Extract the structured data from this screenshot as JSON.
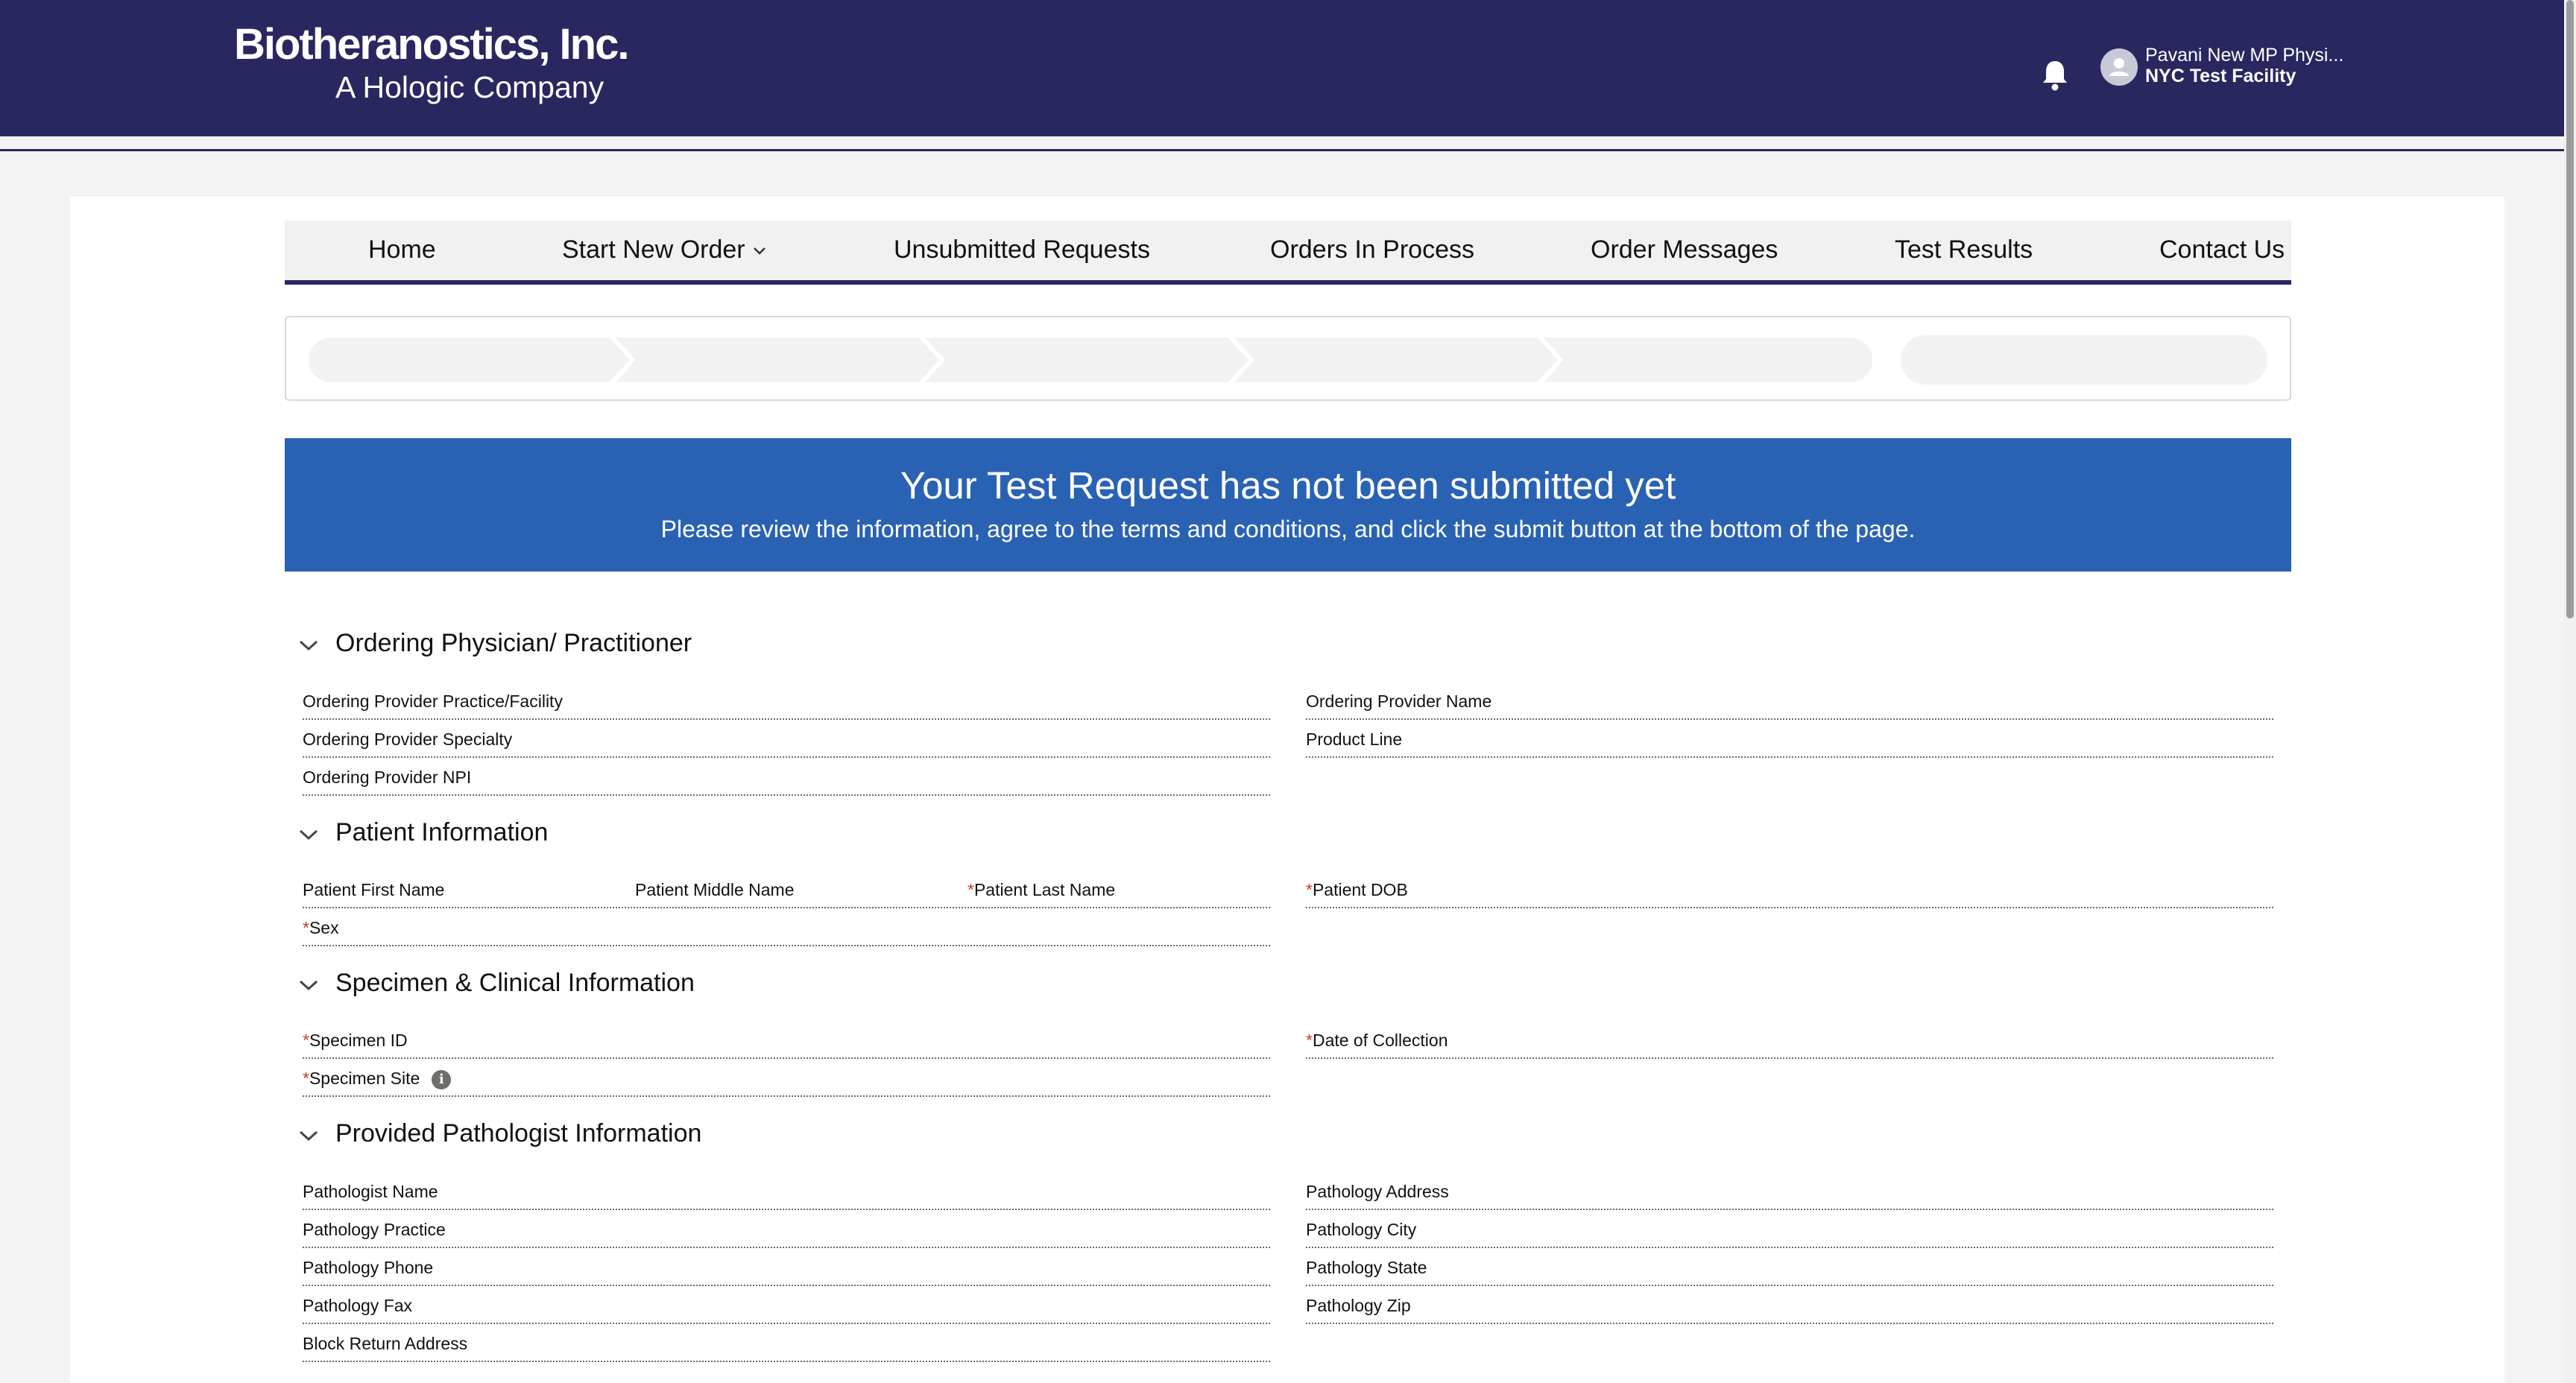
{
  "header": {
    "logo_line1": "Biotheranostics, Inc.",
    "logo_line2": "A Hologic Company",
    "user_name": "Pavani New MP Physi...",
    "user_facility": "NYC Test Facility",
    "bg_color": "#29275f"
  },
  "nav": {
    "items": [
      {
        "label": "Home"
      },
      {
        "label": "Start New Order"
      },
      {
        "label": "Unsubmitted Requests"
      },
      {
        "label": "Orders In Process"
      },
      {
        "label": "Order Messages"
      },
      {
        "label": "Test Results"
      },
      {
        "label": "Contact Us"
      }
    ]
  },
  "banner": {
    "title": "Your Test Request has not been submitted yet",
    "subtitle": "Please review the information, agree to the terms and conditions, and click the submit button at the bottom of the page.",
    "color": "#2a62b3"
  },
  "sections": {
    "physician": {
      "title": "Ordering Physician/ Practitioner",
      "fields": {
        "practice": "Ordering Provider Practice/Facility",
        "name": "Ordering Provider Name",
        "specialty": "Ordering Provider Specialty",
        "product_line": "Product Line",
        "npi": "Ordering Provider NPI"
      }
    },
    "patient": {
      "title": "Patient Information",
      "fields": {
        "first_name": "Patient First Name",
        "middle_name": "Patient Middle Name",
        "last_name": "Patient Last Name",
        "dob": "Patient DOB",
        "sex": "Sex"
      }
    },
    "specimen": {
      "title": "Specimen & Clinical Information",
      "fields": {
        "specimen_id": "Specimen ID",
        "date_of_collection": "Date of Collection",
        "specimen_site": "Specimen Site"
      }
    },
    "pathologist": {
      "title": "Provided Pathologist Information",
      "fields": {
        "name": "Pathologist Name",
        "address": "Pathology Address",
        "practice": "Pathology Practice",
        "city": "Pathology City",
        "phone": "Pathology Phone",
        "state": "Pathology State",
        "fax": "Pathology Fax",
        "zip": "Pathology Zip",
        "block_return": "Block Return Address"
      }
    }
  },
  "required_marker": "*",
  "icons": {
    "bell": "bell-icon",
    "avatar": "user-avatar-icon",
    "info": "info-icon",
    "chevron": "chevron-down-icon"
  }
}
